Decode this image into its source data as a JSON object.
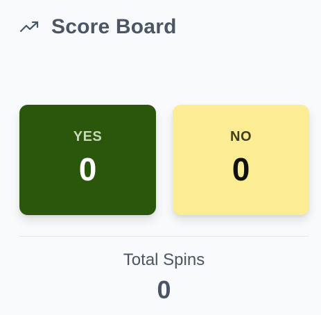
{
  "header": {
    "icon": "trending-up-icon",
    "title": "Score Board"
  },
  "cards": {
    "yes": {
      "label": "YES",
      "value": "0",
      "color": "#2b570c"
    },
    "no": {
      "label": "NO",
      "value": "0",
      "color": "#fcec93"
    }
  },
  "total": {
    "label": "Total Spins",
    "value": "0"
  }
}
